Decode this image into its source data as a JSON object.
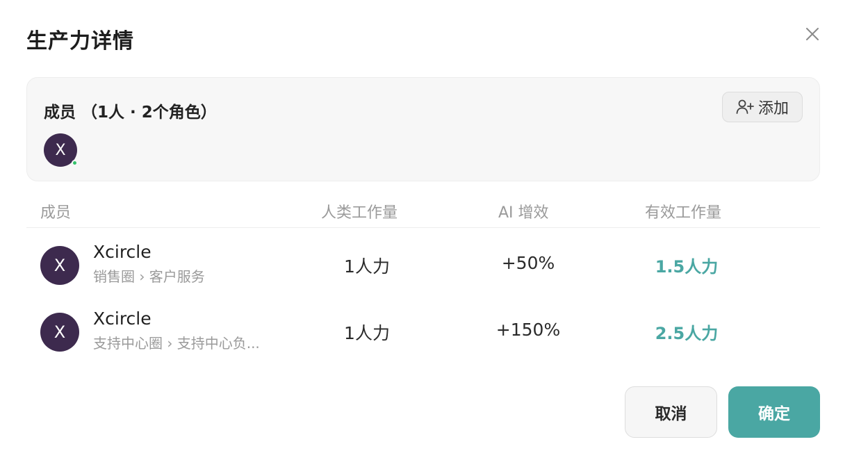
{
  "dialog": {
    "title": "生产力详情"
  },
  "members_card": {
    "title": "成员",
    "count_text": "（1人 · 2个角色）",
    "add_label": "添加",
    "avatar_initial": "X"
  },
  "table": {
    "headers": {
      "member": "成员",
      "human_work": "人类工作量",
      "ai_boost": "AI 增效",
      "effective_work": "有效工作量"
    },
    "rows": [
      {
        "initial": "X",
        "name": "Xcircle",
        "path": "销售圈 › 客户服务",
        "human_work": "1人力",
        "ai_boost": "+50%",
        "effective_work": "1.5人力"
      },
      {
        "initial": "X",
        "name": "Xcircle",
        "path": "支持中心圈 › 支持中心负...",
        "human_work": "1人力",
        "ai_boost": "+150%",
        "effective_work": "2.5人力"
      }
    ]
  },
  "footer": {
    "cancel_label": "取消",
    "confirm_label": "确定"
  },
  "colors": {
    "accent": "#4aa7a3",
    "avatar_bg": "#3d2a4e",
    "online": "#34c26b"
  },
  "icons": {
    "close": "close-icon",
    "add_user": "user-plus-icon"
  }
}
